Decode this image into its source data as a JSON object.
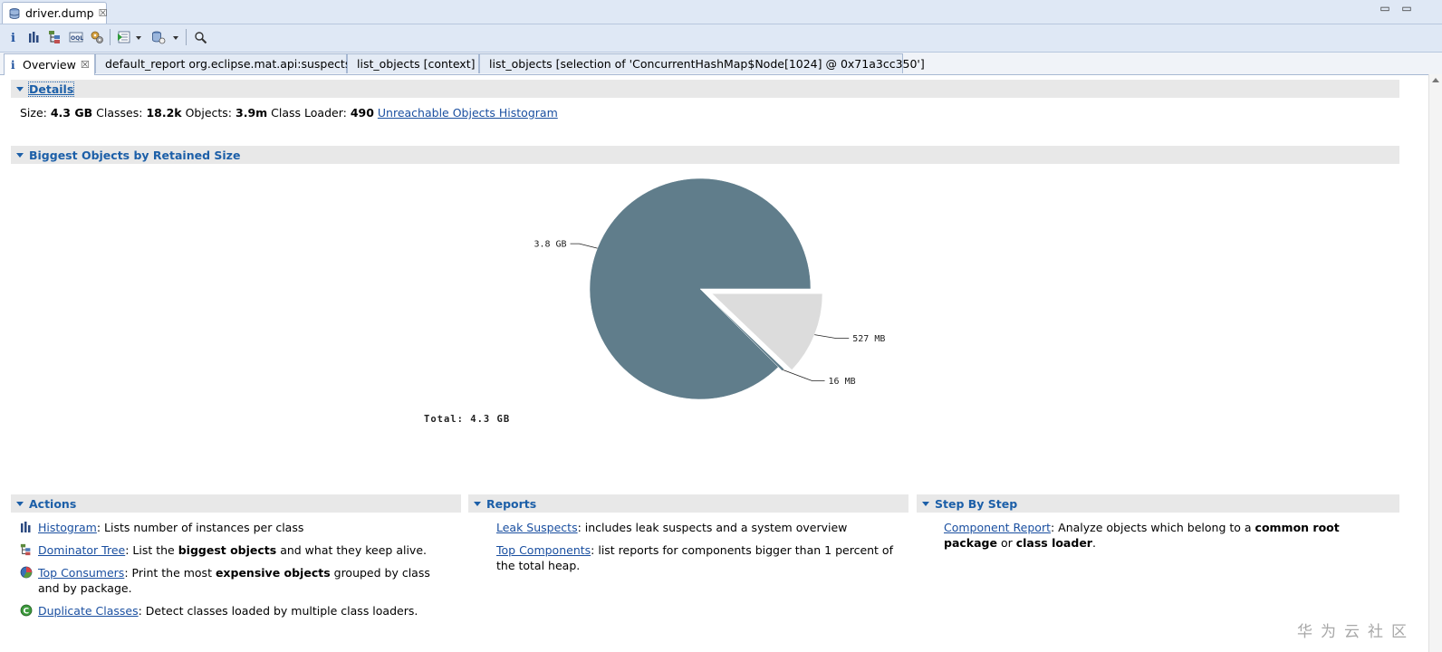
{
  "editor_tab": {
    "title": "driver.dump",
    "close": "☒"
  },
  "window_controls": {
    "minimize": "▭",
    "maximize": "▭"
  },
  "subtabs": [
    {
      "label": "Overview",
      "close": "☒"
    },
    {
      "label": "default_report  org.eclipse.mat.api:suspects"
    },
    {
      "label": "list_objects  [context]"
    },
    {
      "label": "list_objects  [selection of 'ConcurrentHashMap$Node[1024] @ 0x71a3cc350']"
    }
  ],
  "details": {
    "header": "Details",
    "size_label": "Size:",
    "size_value": "4.3 GB",
    "classes_label": "Classes:",
    "classes_value": "18.2k",
    "objects_label": "Objects:",
    "objects_value": "3.9m",
    "loader_label": "Class Loader:",
    "loader_value": "490",
    "unreachable_link": "Unreachable Objects Histogram"
  },
  "biggest": {
    "header": "Biggest Objects by Retained Size"
  },
  "chart_data": {
    "type": "pie",
    "slices": [
      {
        "label": "3.8 GB",
        "value": 3800,
        "color": "#607d8b"
      },
      {
        "label": "527 MB",
        "value": 527,
        "color": "#dcdcdc"
      },
      {
        "label": "16 MB",
        "value": 16,
        "color": "#607d8b"
      }
    ],
    "total_label": "Total: 4.3 GB"
  },
  "actions": {
    "header": "Actions",
    "items": [
      {
        "icon": "histogram-icon",
        "link": "Histogram",
        "pre": ": Lists number of instances per class",
        "bold": "",
        "post": ""
      },
      {
        "icon": "dominator-tree-icon",
        "link": "Dominator Tree",
        "pre": ": List the ",
        "bold": "biggest objects",
        "post": " and what they keep alive."
      },
      {
        "icon": "top-consumers-icon",
        "link": "Top Consumers",
        "pre": ": Print the most ",
        "bold": "expensive objects",
        "post": " grouped by class and by package."
      },
      {
        "icon": "duplicate-classes-icon",
        "link": "Duplicate Classes",
        "pre": ": Detect classes loaded by multiple class loaders.",
        "bold": "",
        "post": ""
      }
    ]
  },
  "reports": {
    "header": "Reports",
    "items": [
      {
        "link": "Leak Suspects",
        "text": ": includes leak suspects and a system overview"
      },
      {
        "link": "Top Components",
        "text": ": list reports for components bigger than 1 percent of the total heap."
      }
    ]
  },
  "steps": {
    "header": "Step By Step",
    "items": [
      {
        "link": "Component Report",
        "pre": ": Analyze objects which belong to a ",
        "bold1": "common root package",
        "mid": " or ",
        "bold2": "class loader",
        "post": "."
      }
    ]
  },
  "watermark": "华为云社区"
}
